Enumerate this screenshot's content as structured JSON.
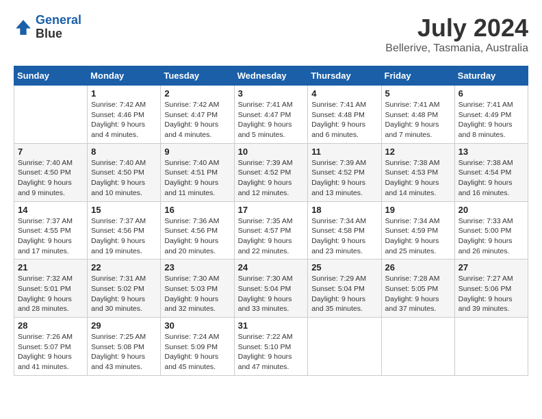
{
  "header": {
    "logo_line1": "General",
    "logo_line2": "Blue",
    "main_title": "July 2024",
    "subtitle": "Bellerive, Tasmania, Australia"
  },
  "weekdays": [
    "Sunday",
    "Monday",
    "Tuesday",
    "Wednesday",
    "Thursday",
    "Friday",
    "Saturday"
  ],
  "weeks": [
    [
      {
        "day": "",
        "sunrise": "",
        "sunset": "",
        "daylight": ""
      },
      {
        "day": "1",
        "sunrise": "Sunrise: 7:42 AM",
        "sunset": "Sunset: 4:46 PM",
        "daylight": "Daylight: 9 hours and 4 minutes."
      },
      {
        "day": "2",
        "sunrise": "Sunrise: 7:42 AM",
        "sunset": "Sunset: 4:47 PM",
        "daylight": "Daylight: 9 hours and 4 minutes."
      },
      {
        "day": "3",
        "sunrise": "Sunrise: 7:41 AM",
        "sunset": "Sunset: 4:47 PM",
        "daylight": "Daylight: 9 hours and 5 minutes."
      },
      {
        "day": "4",
        "sunrise": "Sunrise: 7:41 AM",
        "sunset": "Sunset: 4:48 PM",
        "daylight": "Daylight: 9 hours and 6 minutes."
      },
      {
        "day": "5",
        "sunrise": "Sunrise: 7:41 AM",
        "sunset": "Sunset: 4:48 PM",
        "daylight": "Daylight: 9 hours and 7 minutes."
      },
      {
        "day": "6",
        "sunrise": "Sunrise: 7:41 AM",
        "sunset": "Sunset: 4:49 PM",
        "daylight": "Daylight: 9 hours and 8 minutes."
      }
    ],
    [
      {
        "day": "7",
        "sunrise": "Sunrise: 7:40 AM",
        "sunset": "Sunset: 4:50 PM",
        "daylight": "Daylight: 9 hours and 9 minutes."
      },
      {
        "day": "8",
        "sunrise": "Sunrise: 7:40 AM",
        "sunset": "Sunset: 4:50 PM",
        "daylight": "Daylight: 9 hours and 10 minutes."
      },
      {
        "day": "9",
        "sunrise": "Sunrise: 7:40 AM",
        "sunset": "Sunset: 4:51 PM",
        "daylight": "Daylight: 9 hours and 11 minutes."
      },
      {
        "day": "10",
        "sunrise": "Sunrise: 7:39 AM",
        "sunset": "Sunset: 4:52 PM",
        "daylight": "Daylight: 9 hours and 12 minutes."
      },
      {
        "day": "11",
        "sunrise": "Sunrise: 7:39 AM",
        "sunset": "Sunset: 4:52 PM",
        "daylight": "Daylight: 9 hours and 13 minutes."
      },
      {
        "day": "12",
        "sunrise": "Sunrise: 7:38 AM",
        "sunset": "Sunset: 4:53 PM",
        "daylight": "Daylight: 9 hours and 14 minutes."
      },
      {
        "day": "13",
        "sunrise": "Sunrise: 7:38 AM",
        "sunset": "Sunset: 4:54 PM",
        "daylight": "Daylight: 9 hours and 16 minutes."
      }
    ],
    [
      {
        "day": "14",
        "sunrise": "Sunrise: 7:37 AM",
        "sunset": "Sunset: 4:55 PM",
        "daylight": "Daylight: 9 hours and 17 minutes."
      },
      {
        "day": "15",
        "sunrise": "Sunrise: 7:37 AM",
        "sunset": "Sunset: 4:56 PM",
        "daylight": "Daylight: 9 hours and 19 minutes."
      },
      {
        "day": "16",
        "sunrise": "Sunrise: 7:36 AM",
        "sunset": "Sunset: 4:56 PM",
        "daylight": "Daylight: 9 hours and 20 minutes."
      },
      {
        "day": "17",
        "sunrise": "Sunrise: 7:35 AM",
        "sunset": "Sunset: 4:57 PM",
        "daylight": "Daylight: 9 hours and 22 minutes."
      },
      {
        "day": "18",
        "sunrise": "Sunrise: 7:34 AM",
        "sunset": "Sunset: 4:58 PM",
        "daylight": "Daylight: 9 hours and 23 minutes."
      },
      {
        "day": "19",
        "sunrise": "Sunrise: 7:34 AM",
        "sunset": "Sunset: 4:59 PM",
        "daylight": "Daylight: 9 hours and 25 minutes."
      },
      {
        "day": "20",
        "sunrise": "Sunrise: 7:33 AM",
        "sunset": "Sunset: 5:00 PM",
        "daylight": "Daylight: 9 hours and 26 minutes."
      }
    ],
    [
      {
        "day": "21",
        "sunrise": "Sunrise: 7:32 AM",
        "sunset": "Sunset: 5:01 PM",
        "daylight": "Daylight: 9 hours and 28 minutes."
      },
      {
        "day": "22",
        "sunrise": "Sunrise: 7:31 AM",
        "sunset": "Sunset: 5:02 PM",
        "daylight": "Daylight: 9 hours and 30 minutes."
      },
      {
        "day": "23",
        "sunrise": "Sunrise: 7:30 AM",
        "sunset": "Sunset: 5:03 PM",
        "daylight": "Daylight: 9 hours and 32 minutes."
      },
      {
        "day": "24",
        "sunrise": "Sunrise: 7:30 AM",
        "sunset": "Sunset: 5:04 PM",
        "daylight": "Daylight: 9 hours and 33 minutes."
      },
      {
        "day": "25",
        "sunrise": "Sunrise: 7:29 AM",
        "sunset": "Sunset: 5:04 PM",
        "daylight": "Daylight: 9 hours and 35 minutes."
      },
      {
        "day": "26",
        "sunrise": "Sunrise: 7:28 AM",
        "sunset": "Sunset: 5:05 PM",
        "daylight": "Daylight: 9 hours and 37 minutes."
      },
      {
        "day": "27",
        "sunrise": "Sunrise: 7:27 AM",
        "sunset": "Sunset: 5:06 PM",
        "daylight": "Daylight: 9 hours and 39 minutes."
      }
    ],
    [
      {
        "day": "28",
        "sunrise": "Sunrise: 7:26 AM",
        "sunset": "Sunset: 5:07 PM",
        "daylight": "Daylight: 9 hours and 41 minutes."
      },
      {
        "day": "29",
        "sunrise": "Sunrise: 7:25 AM",
        "sunset": "Sunset: 5:08 PM",
        "daylight": "Daylight: 9 hours and 43 minutes."
      },
      {
        "day": "30",
        "sunrise": "Sunrise: 7:24 AM",
        "sunset": "Sunset: 5:09 PM",
        "daylight": "Daylight: 9 hours and 45 minutes."
      },
      {
        "day": "31",
        "sunrise": "Sunrise: 7:22 AM",
        "sunset": "Sunset: 5:10 PM",
        "daylight": "Daylight: 9 hours and 47 minutes."
      },
      {
        "day": "",
        "sunrise": "",
        "sunset": "",
        "daylight": ""
      },
      {
        "day": "",
        "sunrise": "",
        "sunset": "",
        "daylight": ""
      },
      {
        "day": "",
        "sunrise": "",
        "sunset": "",
        "daylight": ""
      }
    ]
  ]
}
